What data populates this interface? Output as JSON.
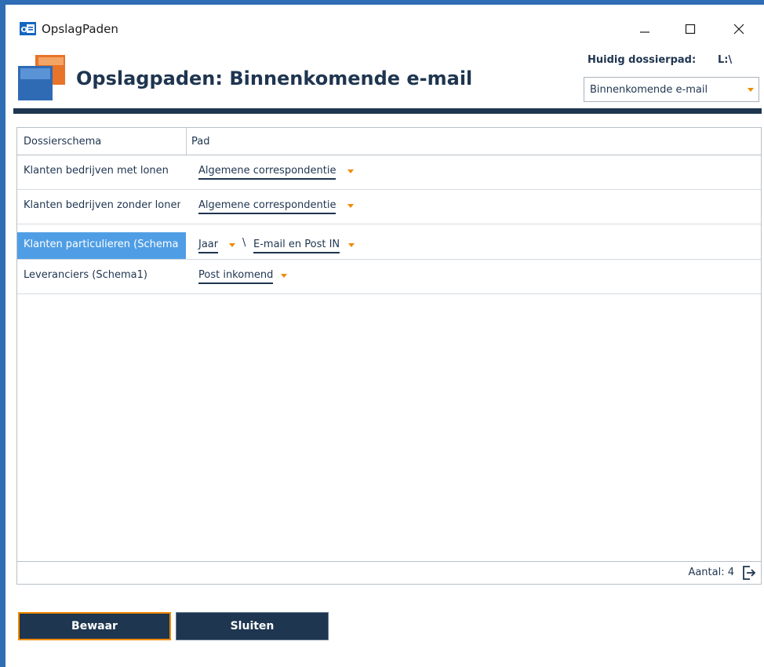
{
  "window": {
    "title": "OpslagPaden",
    "app_icon": "outlook-icon",
    "controls": [
      "minimize-icon",
      "maximize-icon",
      "close-icon"
    ]
  },
  "header": {
    "title": "Opslagpaden: Binnenkomende e-mail",
    "current_path_label": "Huidig dossierpad:",
    "current_path_value": "L:\\",
    "mode_select_value": "Binnenkomende e-mail"
  },
  "grid": {
    "columns": [
      "Dossierschema",
      "Pad"
    ],
    "rows": [
      {
        "schema": "Klanten bedrijven met lonen",
        "segments": [
          "Algemene correspondentie"
        ],
        "selected": false
      },
      {
        "schema": "Klanten bedrijven zonder lonen",
        "segments": [
          "Algemene correspondentie"
        ],
        "selected": false
      },
      {
        "schema": "Klanten particulieren (Schema",
        "segments": [
          "Jaar",
          "E-mail en Post IN"
        ],
        "separator": "\\",
        "selected": true
      },
      {
        "schema": "Leveranciers (Schema1)",
        "segments": [
          "Post inkomend"
        ],
        "selected": false
      }
    ],
    "count_label": "Aantal: 4"
  },
  "buttons": {
    "save": "Bewaar",
    "close": "Sluiten"
  },
  "colors": {
    "accent": "#f08a00",
    "navy": "#1e3650",
    "selection": "#4f9ee5",
    "frame": "#2f6db5"
  }
}
